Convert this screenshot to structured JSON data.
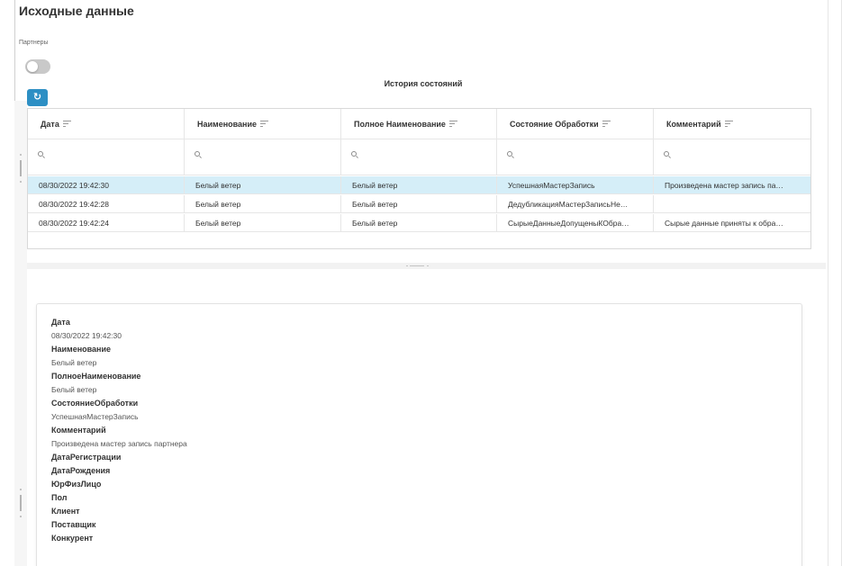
{
  "page": {
    "title": "Исходные данные",
    "partners_label": "Партнеры"
  },
  "history": {
    "title": "История состояний",
    "refresh_icon": "↻",
    "columns": [
      {
        "label": "Дата"
      },
      {
        "label": "Наименование"
      },
      {
        "label": "Полное Наименование"
      },
      {
        "label": "Состояние Обработки"
      },
      {
        "label": "Комментарий"
      }
    ],
    "rows": [
      {
        "date": "08/30/2022 19:42:30",
        "name": "Белый ветер",
        "full_name": "Белый ветер",
        "state": "УспешнаяМастерЗапись",
        "comment": "Произведена мастер запись па…",
        "selected": true
      },
      {
        "date": "08/30/2022 19:42:28",
        "name": "Белый ветер",
        "full_name": "Белый ветер",
        "state": "ДедубликацияМастерЗаписьНе…",
        "comment": "",
        "selected": false
      },
      {
        "date": "08/30/2022 19:42:24",
        "name": "Белый ветер",
        "full_name": "Белый ветер",
        "state": "СырыеДанныеДопущеныКОбра…",
        "comment": "Сырые данные приняты к обра…",
        "selected": false
      }
    ]
  },
  "detail": {
    "fields": [
      {
        "label": "Дата",
        "value": "08/30/2022 19:42:30"
      },
      {
        "label": "Наименование",
        "value": "Белый ветер"
      },
      {
        "label": "ПолноеНаименование",
        "value": "Белый ветер"
      },
      {
        "label": "СостояниеОбработки",
        "value": "УспешнаяМастерЗапись"
      },
      {
        "label": "Комментарий",
        "value": "Произведена мастер запись партнера"
      },
      {
        "label": "ДатаРегистрации",
        "value": ""
      },
      {
        "label": "ДатаРождения",
        "value": ""
      },
      {
        "label": "ЮрФизЛицо",
        "value": ""
      },
      {
        "label": "Пол",
        "value": ""
      },
      {
        "label": "Клиент",
        "value": ""
      },
      {
        "label": "Поставщик",
        "value": ""
      },
      {
        "label": "Конкурент",
        "value": ""
      }
    ]
  },
  "colors": {
    "accent": "#2d8fc4",
    "selected_row": "#d5eef8",
    "toggle_off": "#c9c9c9"
  }
}
